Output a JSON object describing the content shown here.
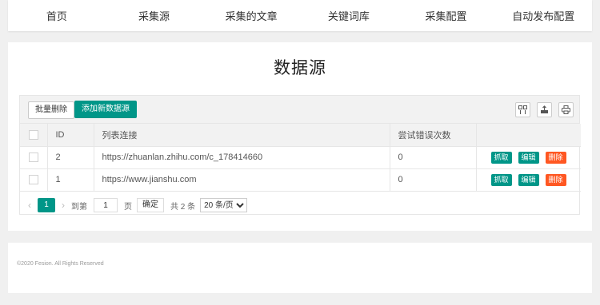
{
  "nav": {
    "items": [
      "首页",
      "采集源",
      "采集的文章",
      "关键词库",
      "采集配置",
      "自动发布配置"
    ]
  },
  "page": {
    "title": "数据源"
  },
  "toolbar": {
    "batch_delete": "批量删除",
    "add_source": "添加新数据源",
    "icons": [
      "columns-icon",
      "export-icon",
      "print-icon"
    ]
  },
  "table": {
    "columns": [
      "ID",
      "列表连接",
      "尝试错误次数"
    ],
    "rows": [
      {
        "id": "2",
        "url": "https://zhuanlan.zhihu.com/c_178414660",
        "errors": "0"
      },
      {
        "id": "1",
        "url": "https://www.jianshu.com",
        "errors": "0"
      }
    ],
    "actions": {
      "fetch": "抓取",
      "edit": "编辑",
      "delete": "删除"
    }
  },
  "pager": {
    "prev": "‹",
    "current": "1",
    "next": "›",
    "goto_label": "到第",
    "goto_value": "1",
    "page_unit": "页",
    "confirm": "确定",
    "total": "共 2 条",
    "page_size": "20 条/页"
  },
  "footer": {
    "copyright": "©2020 Fesion. All Rights Reserved"
  },
  "colors": {
    "primary": "#009688",
    "danger": "#FF5722"
  }
}
